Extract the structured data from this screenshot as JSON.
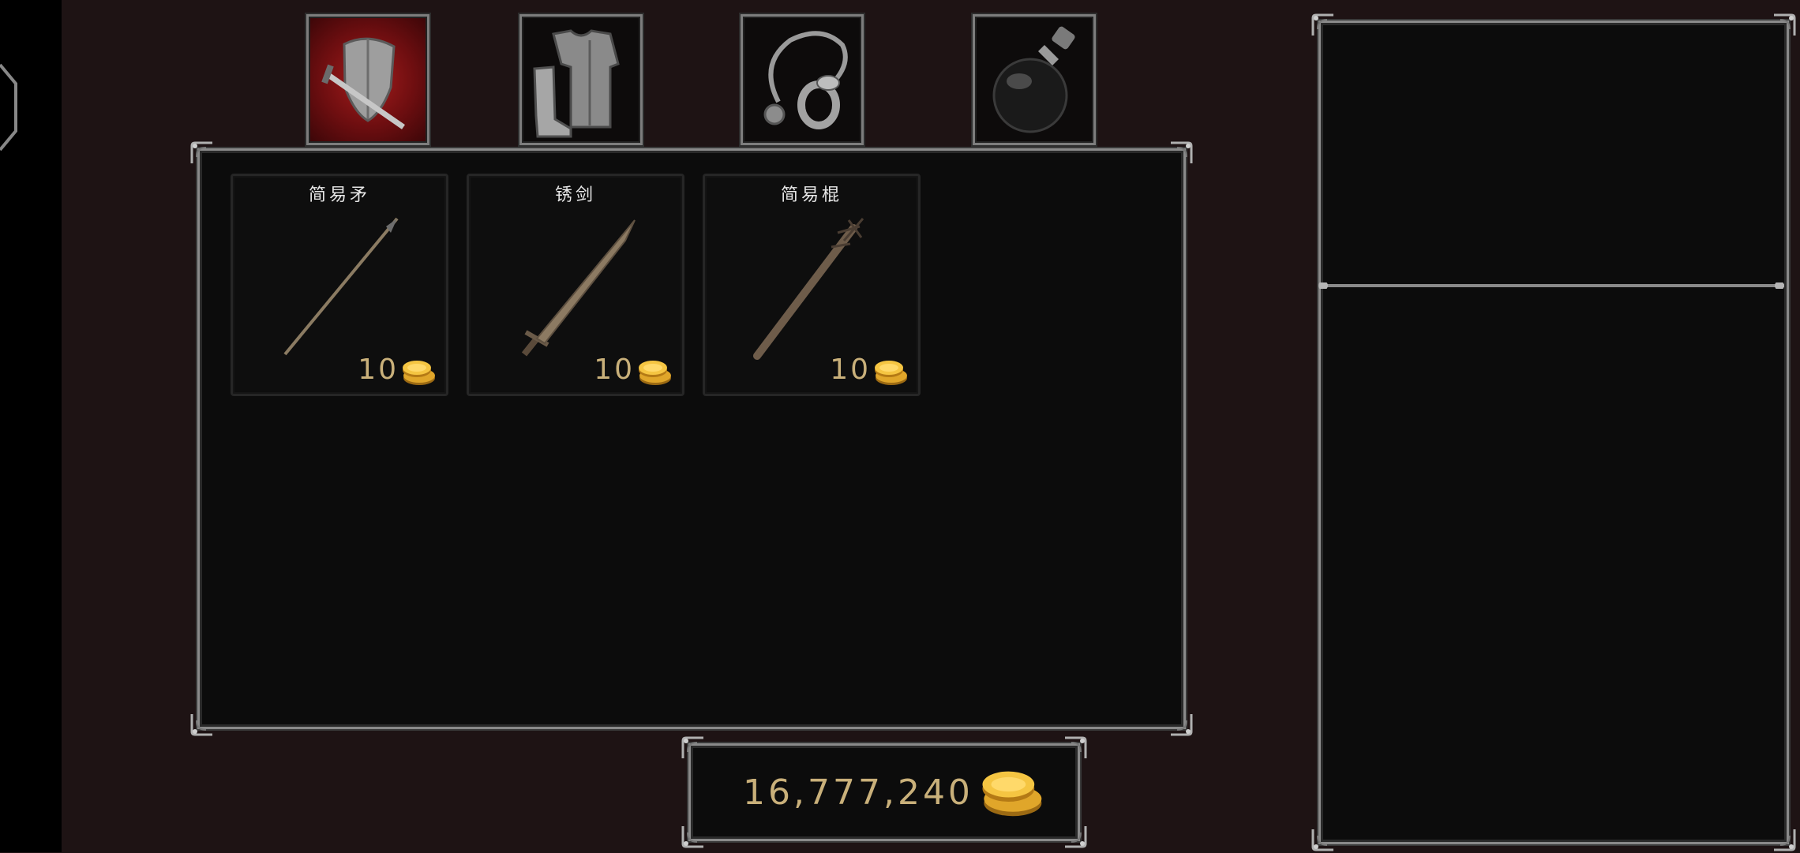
{
  "tabs": [
    {
      "name": "weapons",
      "icon": "shield-sword-icon",
      "selected": true
    },
    {
      "name": "armor",
      "icon": "armor-icon",
      "selected": false
    },
    {
      "name": "accessories",
      "icon": "ring-amulet-icon",
      "selected": false
    },
    {
      "name": "consumables",
      "icon": "potion-icon",
      "selected": false
    }
  ],
  "items": [
    {
      "name": "简易矛",
      "price": "10",
      "icon": "spear-icon"
    },
    {
      "name": "锈剑",
      "price": "10",
      "icon": "rusty-sword-icon"
    },
    {
      "name": "简易棍",
      "price": "10",
      "icon": "spiked-club-icon"
    }
  ],
  "player": {
    "gold": "16,777,240"
  },
  "colors": {
    "price_gold": "#c9b07a",
    "tab_selected": "#a51c1c",
    "frame_silver": "#8a8a8a"
  }
}
